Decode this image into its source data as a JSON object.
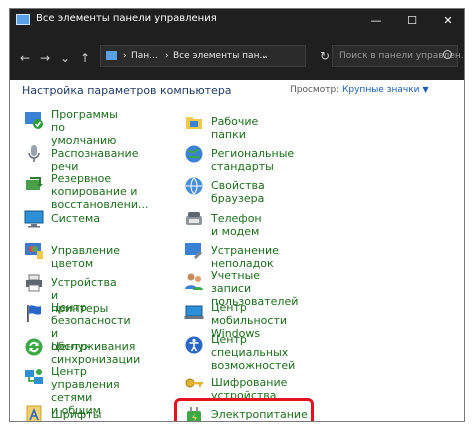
{
  "window": {
    "title": "Все элементы панели управления",
    "controls": {
      "minimize": "—",
      "maximize": "☐",
      "close": "✕"
    }
  },
  "nav": {
    "back": "←",
    "forward": "→",
    "down": "⌄",
    "up": "↑",
    "breadcrumb": [
      "Пан...",
      "Все элементы пан..."
    ],
    "separator": "›",
    "search_placeholder": "Поиск в панели управлен..."
  },
  "header": {
    "title": "Настройка параметров компьютера",
    "view_label": "Просмотр:",
    "view_value": "Крупные значки"
  },
  "items_left": [
    {
      "label": "Программы по\nумолчанию",
      "icon": "default-programs-icon"
    },
    {
      "label": "Распознавание речи",
      "icon": "microphone-icon"
    },
    {
      "label": "Резервное копирование и\nвосстановлени...",
      "icon": "backup-icon"
    },
    {
      "label": "Система",
      "icon": "system-monitor-icon"
    },
    {
      "label": "Управление цветом",
      "icon": "color-management-icon"
    },
    {
      "label": "Устройства и принтеры",
      "icon": "printer-icon"
    },
    {
      "label": "Центр безопасности и\nобслуживания",
      "icon": "flag-icon"
    },
    {
      "label": "Центр синхронизации",
      "icon": "sync-icon"
    },
    {
      "label": "Центр управления сетями\nи общим доступом",
      "icon": "network-icon"
    },
    {
      "label": "Шрифты",
      "icon": "fonts-icon"
    }
  ],
  "items_right": [
    {
      "label": "Рабочие папки",
      "icon": "work-folders-icon"
    },
    {
      "label": "Региональные стандарты",
      "icon": "region-globe-icon"
    },
    {
      "label": "Свойства браузера",
      "icon": "browser-icon"
    },
    {
      "label": "Телефон и модем",
      "icon": "phone-modem-icon"
    },
    {
      "label": "Устранение неполадок",
      "icon": "troubleshooting-icon"
    },
    {
      "label": "Учетные записи\nпользователей",
      "icon": "user-accounts-icon"
    },
    {
      "label": "Центр мобильности\nWindows",
      "icon": "mobility-center-icon"
    },
    {
      "label": "Центр специальных\nвозможностей",
      "icon": "accessibility-icon"
    },
    {
      "label": "Шифрование устройства",
      "icon": "encryption-key-icon"
    },
    {
      "label": "Электропитание",
      "icon": "power-options-icon"
    }
  ],
  "colors": {
    "link": "#1b6e1b",
    "highlight": "#e3141f",
    "titlebar": "#1f1f1f"
  }
}
